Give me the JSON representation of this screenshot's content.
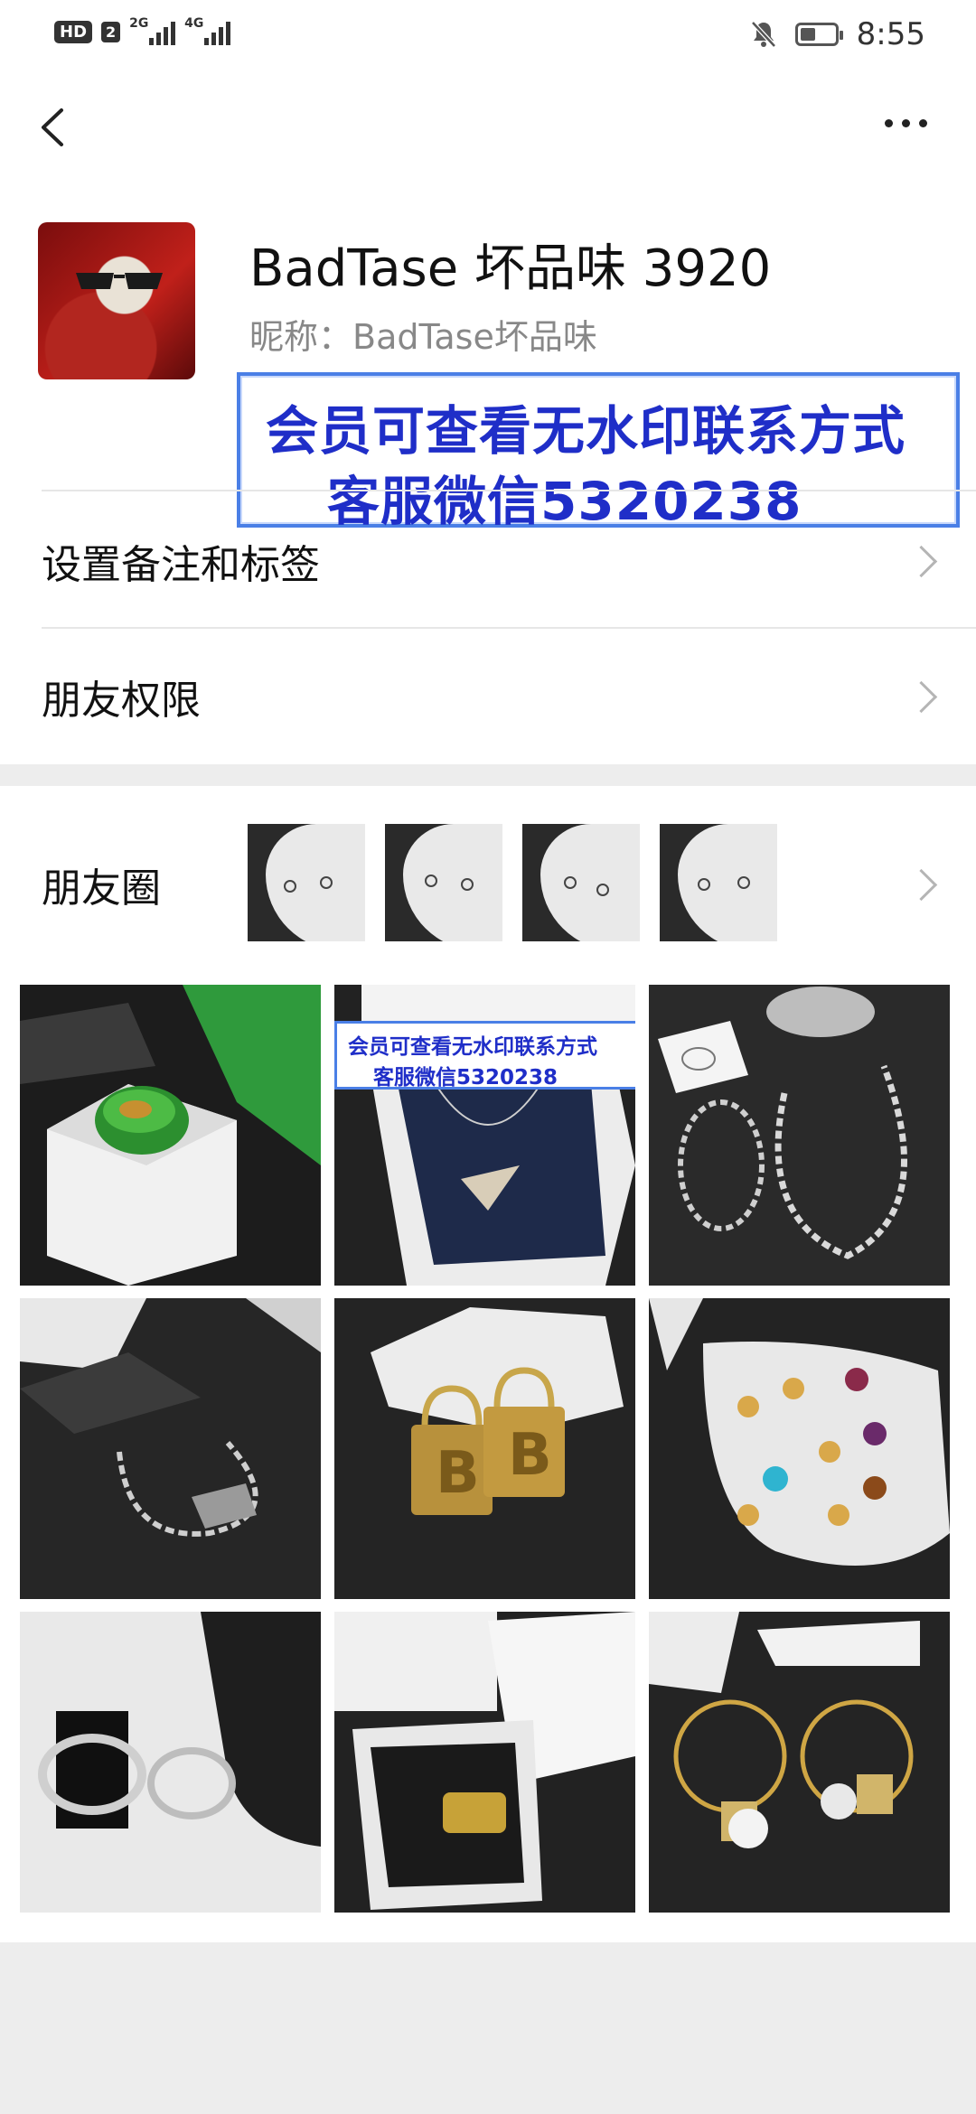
{
  "status_bar": {
    "hd": "HD",
    "sim": "2",
    "net1": "2G",
    "net2": "4G",
    "time": "8:55",
    "battery_level": 0.45
  },
  "profile": {
    "name": "BadTase 坏品味 3920",
    "nickname": "昵称：BadTase坏品味"
  },
  "watermark": {
    "line1": "会员可查看无水印联系方式",
    "line2": "客服微信5320238"
  },
  "menu": {
    "remark": "设置备注和标签",
    "permissions": "朋友权限",
    "moments": "朋友圈"
  }
}
